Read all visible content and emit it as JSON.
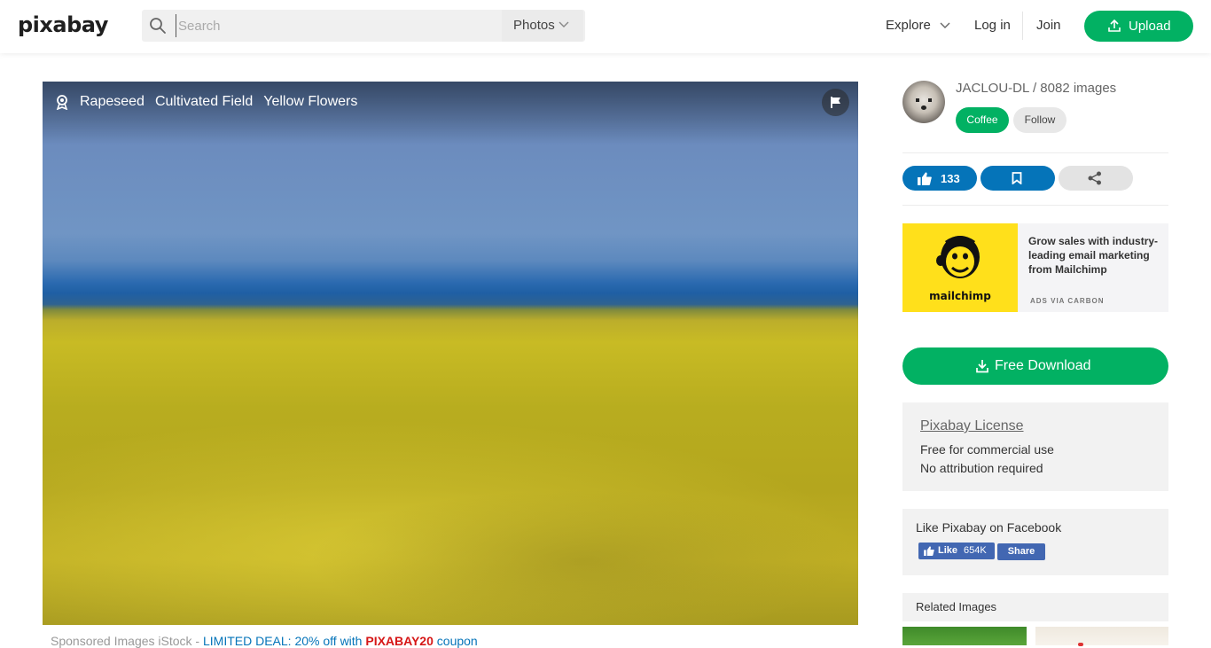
{
  "header": {
    "logo": "pixabay",
    "search_placeholder": "Search",
    "search_type": "Photos",
    "nav": {
      "explore": "Explore",
      "login": "Log in",
      "join": "Join",
      "upload": "Upload"
    }
  },
  "photo": {
    "tags": [
      "Rapeseed",
      "Cultivated Field",
      "Yellow Flowers"
    ]
  },
  "sponsored": {
    "prefix": "Sponsored Images iStock - ",
    "deal": "LIMITED DEAL: 20% off with ",
    "code": "PIXABAY20",
    "suffix": " coupon"
  },
  "sidebar": {
    "user": {
      "name": "JACLOU-DL / 8082 images",
      "coffee_label": "Coffee",
      "follow_label": "Follow"
    },
    "actions": {
      "likes": "133"
    },
    "ad": {
      "brand": "mailchimp",
      "text": "Grow sales with industry-leading email marketing from Mailchimp",
      "via": "ADS VIA CARBON"
    },
    "download_label": "Free Download",
    "license": {
      "title": "Pixabay License",
      "line1": "Free for commercial use",
      "line2": "No attribution required"
    },
    "facebook": {
      "title": "Like Pixabay on Facebook",
      "like_label": "Like",
      "like_count": "654K",
      "share_label": "Share"
    },
    "related_title": "Related Images"
  },
  "colors": {
    "accent": "#02b163",
    "blue": "#0574b9"
  }
}
